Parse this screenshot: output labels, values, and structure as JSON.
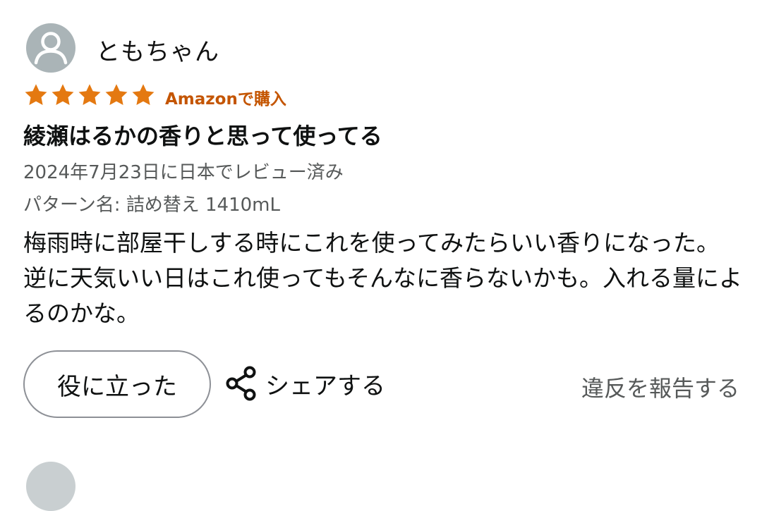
{
  "review": {
    "username": "ともちゃん",
    "avatar_icon": "user-silhouette-icon",
    "rating": 5,
    "rating_max": 5,
    "star_color": "#e47911",
    "verified_label": "Amazonで購入",
    "verified_color": "#c45500",
    "title": "綾瀬はるかの香りと思って使ってる",
    "date_text": "2024年7月23日に日本でレビュー済み",
    "pattern_text": "パターン名: 詰め替え 1410mL",
    "body": "梅雨時に部屋干しする時にこれを使ってみたらいい香りになった。逆に天気いい日はこれ使ってもそんなに香らないかも。入れる量によるのかな。"
  },
  "actions": {
    "helpful_label": "役に立った",
    "share_icon": "share-icon",
    "share_label": "シェアする",
    "report_label": "違反を報告する"
  }
}
